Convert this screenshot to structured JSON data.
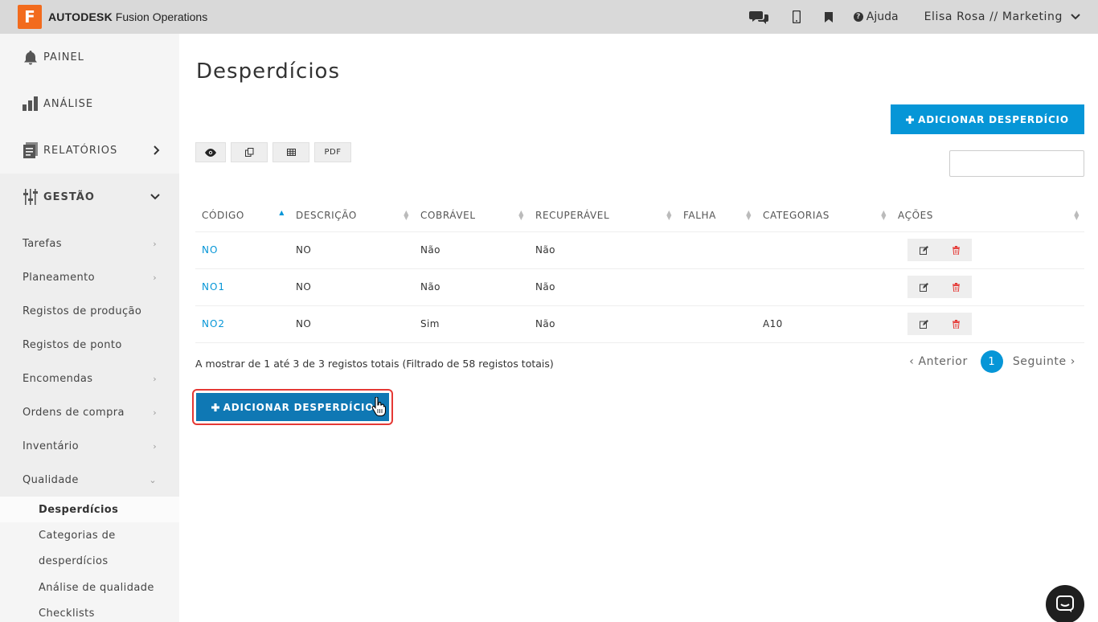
{
  "header": {
    "logo_letter": "F",
    "brand_bold": "AUTODESK",
    "brand_rest": " Fusion Operations",
    "help_label": "Ajuda",
    "user_label": "Elisa Rosa // Marketing"
  },
  "sidebar": {
    "main": [
      {
        "label": "PAINEL",
        "icon": "bell-icon"
      },
      {
        "label": "ANÁLISE",
        "icon": "bar-chart-icon"
      },
      {
        "label": "RELATÓRIOS",
        "icon": "report-icon"
      },
      {
        "label": "GESTÃO",
        "icon": "sliders-icon"
      }
    ],
    "sub": [
      {
        "label": "Tarefas"
      },
      {
        "label": "Planeamento"
      },
      {
        "label": "Registos de produção"
      },
      {
        "label": "Registos de ponto"
      },
      {
        "label": "Encomendas"
      },
      {
        "label": "Ordens de compra"
      },
      {
        "label": "Inventário"
      },
      {
        "label": "Qualidade"
      }
    ],
    "quality": [
      {
        "label": "Desperdícios"
      },
      {
        "label": "Categorias de"
      },
      {
        "label": "desperdícios"
      },
      {
        "label": "Análise de qualidade"
      },
      {
        "label": "Checklists"
      }
    ]
  },
  "main": {
    "title": "Desperdícios",
    "add_button": "ADICIONAR DESPERDÍCIO",
    "tools": {
      "pdf": "PDF"
    },
    "columns": [
      "CÓDIGO",
      "DESCRIÇÃO",
      "COBRÁVEL",
      "RECUPERÁVEL",
      "FALHA",
      "CATEGORIAS",
      "AÇÕES"
    ],
    "rows": [
      {
        "code": "NO",
        "descricao": "NO",
        "cobravel": "Não",
        "recuperavel": "Não",
        "falha": "",
        "categorias": ""
      },
      {
        "code": "NO1",
        "descricao": "NO",
        "cobravel": "Não",
        "recuperavel": "Não",
        "falha": "",
        "categorias": ""
      },
      {
        "code": "NO2",
        "descricao": "NO",
        "cobravel": "Sim",
        "recuperavel": "Não",
        "falha": "",
        "categorias": "A10"
      }
    ],
    "info": "A mostrar de 1 até 3 de 3 registos totais (Filtrado de 58 registos totais)",
    "pager": {
      "prev": "Anterior",
      "page": "1",
      "next": "Seguinte"
    }
  },
  "colors": {
    "accent": "#0696d7",
    "button_dark": "#0f78b4",
    "highlight": "#e53935",
    "logo": "#f26b1d"
  }
}
